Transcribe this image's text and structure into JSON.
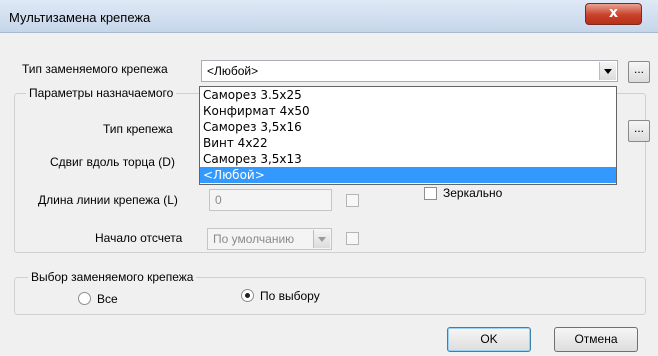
{
  "window": {
    "title": "Мультизамена крепежа",
    "close_symbol": "x"
  },
  "replaced_type": {
    "label": "Тип заменяемого крепежа",
    "value": "<Любой>",
    "browse_label": "..."
  },
  "dropdown": {
    "items": [
      "Саморез 3.5x25",
      "Конфирмат 4x50",
      "Саморез 3,5x16",
      "Винт 4x22",
      "Саморез 3,5x13",
      "<Любой>"
    ],
    "selected_index": 5
  },
  "params": {
    "group_label": "Параметры назначаемого",
    "type_label": "Тип крепежа",
    "type_browse_label": "...",
    "shift_label": "Сдвиг вдоль торца  (D)",
    "length_label": "Длина линии крепежа (L)",
    "length_value": "0",
    "mirror_label": "Зеркально",
    "origin_label": "Начало отсчета",
    "origin_value": "По умолчанию"
  },
  "selection": {
    "group_label": "Выбор заменяемого крепежа",
    "option_all": "Все",
    "option_choice": "По выбору",
    "selected": "По выбору"
  },
  "buttons": {
    "ok": "OK",
    "cancel": "Отмена"
  }
}
